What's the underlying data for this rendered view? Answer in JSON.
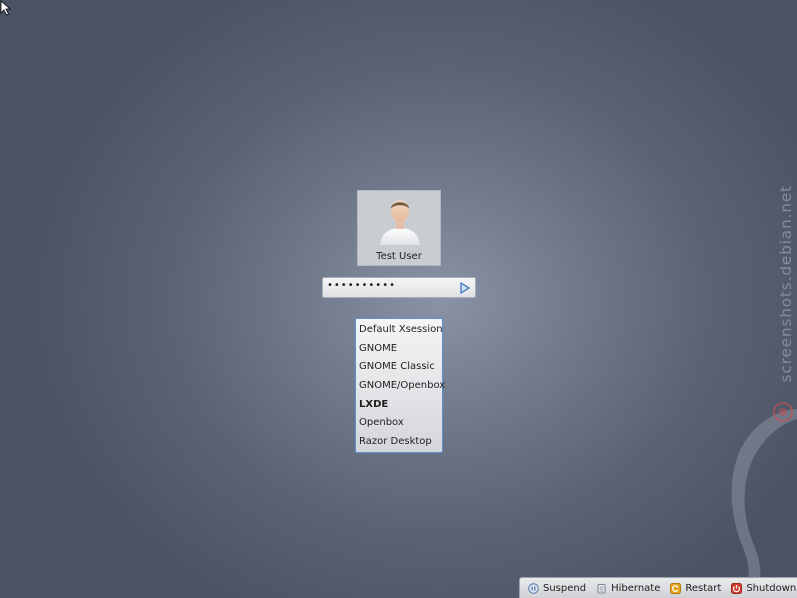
{
  "user": {
    "name": "Test User"
  },
  "password": {
    "masked_value": "••••••••••"
  },
  "sessions": [
    {
      "label": "Default Xsession",
      "selected": false
    },
    {
      "label": "GNOME",
      "selected": false
    },
    {
      "label": "GNOME Classic",
      "selected": false
    },
    {
      "label": "GNOME/Openbox",
      "selected": false
    },
    {
      "label": "LXDE",
      "selected": true
    },
    {
      "label": "Openbox",
      "selected": false
    },
    {
      "label": "Razor Desktop",
      "selected": false
    }
  ],
  "power": {
    "suspend": "Suspend",
    "hibernate": "Hibernate",
    "restart": "Restart",
    "shutdown": "Shutdown"
  },
  "watermark": "screenshots.debian.net",
  "icons": {
    "login": "play-arrow-icon",
    "suspend": "suspend-icon",
    "hibernate": "hibernate-icon",
    "restart": "restart-icon",
    "shutdown": "shutdown-icon"
  },
  "colors": {
    "focus_border": "#5b8fd6",
    "shutdown_red": "#d23a2a",
    "restart_amber": "#e3a21a",
    "login_arrow": "#3b6fb5"
  }
}
